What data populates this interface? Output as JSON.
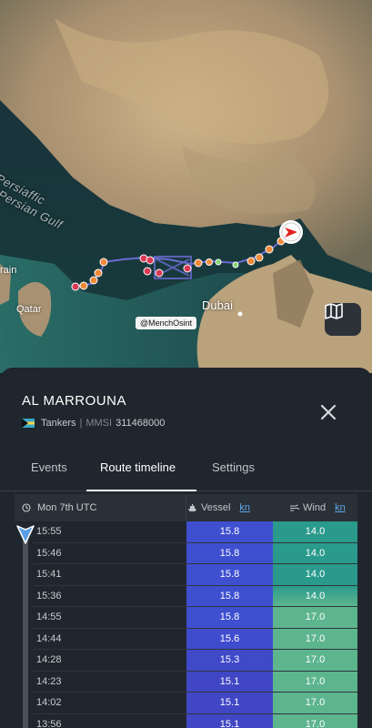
{
  "map": {
    "labels": {
      "gulf": "Persiaffic",
      "gulf2": "Persian Gulf",
      "dubai": "Dubai",
      "qatar": "Qatar",
      "bahrain": "rain",
      "credit": "@MenchOsint"
    },
    "layers_button_icon": "map-icon"
  },
  "vessel": {
    "name": "AL MARROUNA",
    "type": "Tankers",
    "mmsi_label": "MMSI",
    "mmsi": "311468000",
    "flag_icon": "bahamas-flag-icon"
  },
  "tabs": [
    {
      "label": "Events"
    },
    {
      "label": "Route timeline"
    },
    {
      "label": "Settings"
    }
  ],
  "timeline": {
    "date_header": "Mon 7th UTC",
    "vessel_header": "Vessel",
    "vessel_unit": "kn",
    "wind_header": "Wind",
    "wind_unit": "kn",
    "rows": [
      {
        "time": "15:55",
        "vessel": "15.8",
        "wind": "14.0"
      },
      {
        "time": "15:46",
        "vessel": "15.8",
        "wind": "14.0"
      },
      {
        "time": "15:41",
        "vessel": "15.8",
        "wind": "14.0"
      },
      {
        "time": "15:36",
        "vessel": "15.8",
        "wind": "14.0"
      },
      {
        "time": "14:55",
        "vessel": "15.8",
        "wind": "17.0"
      },
      {
        "time": "14:44",
        "vessel": "15.6",
        "wind": "17.0"
      },
      {
        "time": "14:28",
        "vessel": "15.3",
        "wind": "17.0"
      },
      {
        "time": "14:23",
        "vessel": "15.1",
        "wind": "17.0"
      },
      {
        "time": "14:02",
        "vessel": "15.1",
        "wind": "17.0"
      },
      {
        "time": "13:56",
        "vessel": "15.1",
        "wind": "17.0"
      }
    ]
  },
  "colors": {
    "vessel_cell": "#3e4fd0",
    "wind_14": "#2a9a8c",
    "wind_17": "#5db58e",
    "track_orange": "#f08a3a",
    "track_red": "#d83a55"
  }
}
